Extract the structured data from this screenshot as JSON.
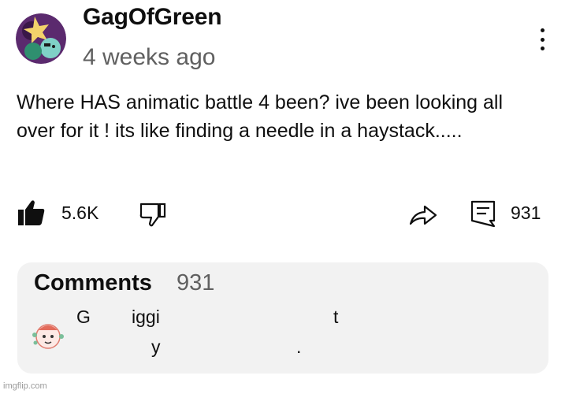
{
  "post": {
    "author": "GagOfGreen",
    "timestamp": "4 weeks ago",
    "text": "Where HAS animatic battle 4 been? ive been looking all over for it ! its like finding a needle in a haystack.....",
    "more_icon": "more-vert-icon"
  },
  "actions": {
    "like_count": "5.6K",
    "reply_count": "931",
    "icons": [
      "thumb-up-icon",
      "thumb-down-icon",
      "share-icon",
      "comment-icon"
    ]
  },
  "comments": {
    "title": "Comments",
    "count": "931",
    "preview": {
      "fragments": [
        "G",
        "iggi",
        "t",
        "y",
        "."
      ]
    }
  },
  "watermark": "imgflip.com"
}
